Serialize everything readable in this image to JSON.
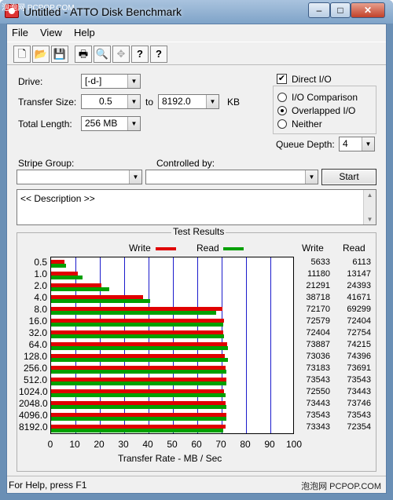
{
  "watermark_top": "泡泡网 PCPOP.COM",
  "title": "Untitled - ATTO Disk Benchmark",
  "window_buttons": {
    "minimize": "–",
    "maximize": "□",
    "close": "✕"
  },
  "menu": [
    "File",
    "View",
    "Help"
  ],
  "toolbar_icons": [
    "new-icon",
    "open-icon",
    "save-icon",
    "print-icon",
    "print-preview-icon",
    "move-icon",
    "help-icon",
    "context-help-icon"
  ],
  "toolbar_glyphs": [
    "🗋",
    "📂",
    "💾",
    "🖶",
    "🔍",
    "✥",
    "?",
    "?"
  ],
  "drive": {
    "label": "Drive:",
    "value": "[-d-]"
  },
  "transfer_size": {
    "label": "Transfer Size:",
    "from": "0.5",
    "to_label": "to",
    "to": "8192.0",
    "unit": "KB"
  },
  "total_length": {
    "label": "Total Length:",
    "value": "256 MB"
  },
  "direct_io": {
    "label": "Direct I/O",
    "checked": true
  },
  "io_mode": {
    "options": [
      {
        "label": "I/O Comparison",
        "selected": false
      },
      {
        "label": "Overlapped I/O",
        "selected": true
      },
      {
        "label": "Neither",
        "selected": false
      }
    ]
  },
  "queue_depth": {
    "label": "Queue Depth:",
    "value": "4"
  },
  "stripe_group": {
    "label": "Stripe Group:",
    "value": ""
  },
  "controlled_by": {
    "label": "Controlled by:",
    "value": ""
  },
  "start_button": "Start",
  "description": "<< Description >>",
  "results": {
    "title": "Test Results",
    "legend_write": "Write",
    "legend_read": "Read",
    "col_write": "Write",
    "col_read": "Read",
    "write_color": "#e00000",
    "read_color": "#00a000",
    "grid_color": "#1b1bcc"
  },
  "chart_data": {
    "type": "bar",
    "orientation": "horizontal",
    "categories": [
      "0.5",
      "1.0",
      "2.0",
      "4.0",
      "8.0",
      "16.0",
      "32.0",
      "64.0",
      "128.0",
      "256.0",
      "512.0",
      "1024.0",
      "2048.0",
      "4096.0",
      "8192.0"
    ],
    "series": [
      {
        "name": "Write",
        "values": [
          5633,
          11180,
          21291,
          38718,
          72170,
          72579,
          72404,
          73887,
          73036,
          73183,
          73543,
          72550,
          73443,
          73543,
          73343
        ]
      },
      {
        "name": "Read",
        "values": [
          6113,
          13147,
          24393,
          41671,
          69299,
          72404,
          72754,
          74215,
          74396,
          73691,
          73543,
          73443,
          73746,
          73543,
          72354
        ]
      }
    ],
    "xlabel": "Transfer Rate - MB / Sec",
    "xticks": [
      0,
      10,
      20,
      30,
      40,
      50,
      60,
      70,
      80,
      90,
      100
    ],
    "xlim": [
      0,
      100
    ],
    "grid": true,
    "legend": "top"
  },
  "status_text": "For Help, press F1",
  "watermark_bottom": "泡泡网 PCPOP.COM"
}
